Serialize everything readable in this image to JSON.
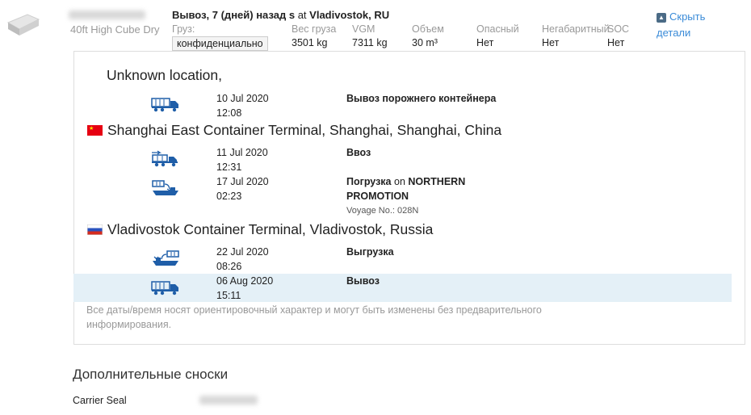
{
  "header": {
    "container_type": "40ft High Cube Dry",
    "event_label": "Вывоз, 7 (дней) назад s",
    "at_word": "at",
    "location": "Vladivostok, RU",
    "cargo": {
      "label": "Груз:",
      "value": "конфиденциально"
    },
    "columns": [
      {
        "label": "Вес груза",
        "value": "3501 kg"
      },
      {
        "label": "VGM",
        "value": "7311 kg"
      },
      {
        "label": "Объем",
        "value": "30 m³"
      },
      {
        "label": "Опасный",
        "value": "Нет"
      },
      {
        "label": "Негабаритный",
        "value": "Нет"
      },
      {
        "label": "SOC",
        "value": "Нет"
      }
    ],
    "hide_link": "Скрыть детали"
  },
  "locations": [
    {
      "name": "Unknown location,",
      "flag": "",
      "events": [
        {
          "icon": "truck-container-icon",
          "date": "10 Jul 2020",
          "time": "12:08",
          "desc_bold": "Вывоз порожнего контейнера"
        }
      ]
    },
    {
      "name": "Shanghai East Container Terminal, Shanghai, Shanghai, China",
      "flag": "china-flag-icon",
      "events": [
        {
          "icon": "gate-in-icon",
          "date": "11 Jul 2020",
          "time": "12:31",
          "desc_bold": "Ввоз"
        },
        {
          "icon": "vessel-loading-icon",
          "date": "17 Jul 2020",
          "time": "02:23",
          "desc_bold": "Погрузка",
          "desc_mid": "on",
          "desc_bold2": "NORTHERN",
          "desc_bold3": "PROMOTION",
          "voyage": "Voyage No.: 028N"
        }
      ]
    },
    {
      "name": "Vladivostok Container Terminal, Vladivostok, Russia",
      "flag": "russia-flag-icon",
      "events": [
        {
          "icon": "vessel-discharge-icon",
          "date": "22 Jul 2020",
          "time": "08:26",
          "desc_bold": "Выгрузка"
        },
        {
          "icon": "truck-container-icon",
          "date": "06 Aug 2020",
          "time": "15:11",
          "desc_bold": "Вывоз",
          "highlight": true
        }
      ]
    }
  ],
  "disclaimer": "Все даты/время носят ориентировочный характер и могут быть изменены без предварительного информирования.",
  "footnotes_title": "Дополнительные сноски",
  "carrier_seal_label": "Carrier Seal",
  "colors": {
    "link": "#3a8bd8",
    "highlight_row": "#e4f0f7",
    "icon_blue": "#1f5ea8",
    "muted": "#999999"
  }
}
